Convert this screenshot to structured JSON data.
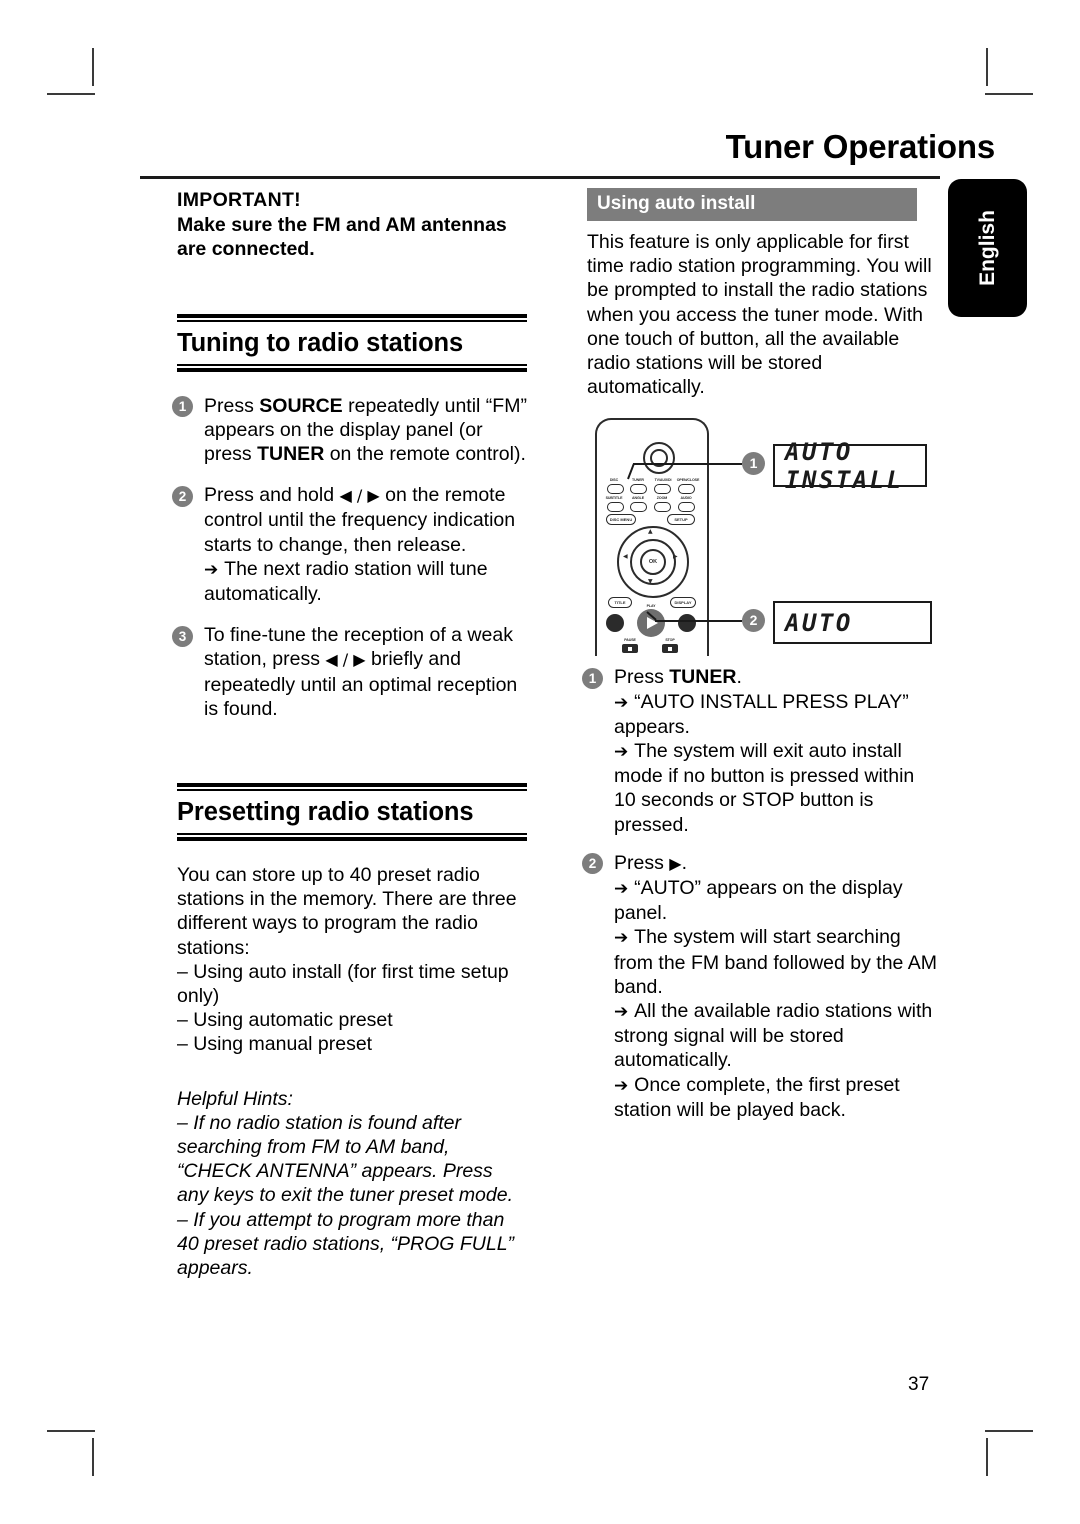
{
  "header": {
    "title": "Tuner Operations",
    "language_tab": "English"
  },
  "page_number": "37",
  "left_column": {
    "important": {
      "heading": "IMPORTANT!",
      "line1": "Make sure the FM and AM antennas",
      "line2": "are connected."
    },
    "section1": {
      "heading": "Tuning to radio stations",
      "steps": [
        {
          "num": "1",
          "parts": [
            {
              "t": "Press ",
              "b": false
            },
            {
              "t": "SOURCE",
              "b": true
            },
            {
              "t": " repeatedly until “FM” appears on the display panel (or press ",
              "b": false
            },
            {
              "t": "TUNER",
              "b": true
            },
            {
              "t": " on the remote control).",
              "b": false
            }
          ],
          "notes": []
        },
        {
          "num": "2",
          "parts": [
            {
              "t": "Press and hold ",
              "b": false
            },
            {
              "t": "◀ / ▶",
              "b": false,
              "tri": true
            },
            {
              "t": " on the remote control until the frequency indication starts to change, then release.",
              "b": false
            }
          ],
          "notes": [
            "The next radio station will tune automatically."
          ]
        },
        {
          "num": "3",
          "parts": [
            {
              "t": "To fine-tune the reception of a weak station, press ",
              "b": false
            },
            {
              "t": "◀ / ▶",
              "b": false,
              "tri": true
            },
            {
              "t": " briefly and repeatedly until an optimal reception is found.",
              "b": false
            }
          ],
          "notes": []
        }
      ]
    },
    "section2": {
      "heading": "Presetting radio stations",
      "intro": "You can store up to 40 preset radio stations in the memory.  There are three different ways to program the radio stations:",
      "dash_items": [
        "Using auto install (for first time setup only)",
        "Using automatic preset",
        "Using manual preset"
      ],
      "hints_heading": "Helpful Hints:",
      "hints": [
        "If no radio station is found after searching from FM to AM band, “CHECK ANTENNA” appears.  Press any keys to exit the tuner preset mode.",
        "If you attempt to program more than 40 preset radio stations, “PROG FULL” appears."
      ]
    }
  },
  "right_column": {
    "subhead": "Using auto install",
    "intro": "This feature is only applicable for first time radio station programming.  You will be prompted to install the radio stations when you access the tuner mode.  With one touch of button, all the available radio stations will be stored automatically.",
    "figure": {
      "remote_buttons_row1": [
        "DISC",
        "TUNER",
        "TV/AUX/DI",
        "OPEN/CLOSE"
      ],
      "remote_buttons_row2": [
        "SUBTITLE",
        "ANGLE",
        "ZOOM",
        "AUDIO"
      ],
      "remote_disc_menu": "DISC MENU",
      "remote_setup": "SETUP",
      "remote_ok": "OK",
      "remote_title": "TITLE",
      "remote_display": "DISPLAY",
      "remote_play": "PLAY",
      "remote_pause": "PAUSE",
      "remote_stop": "STOP",
      "callout1": "1",
      "callout2": "2",
      "lcd1": "AUTO INSTALL",
      "lcd2": "AUTO"
    },
    "steps": [
      {
        "num": "1",
        "parts": [
          {
            "t": "Press ",
            "b": false
          },
          {
            "t": "TUNER",
            "b": true
          },
          {
            "t": ".",
            "b": false
          }
        ],
        "notes": [
          "“AUTO INSTALL PRESS PLAY” appears.",
          "The system will exit auto install mode if no button is pressed within 10 seconds or STOP button is pressed."
        ]
      },
      {
        "num": "2",
        "parts": [
          {
            "t": "Press ",
            "b": false
          },
          {
            "t": "▶",
            "b": false,
            "tri": true
          },
          {
            "t": ".",
            "b": false
          }
        ],
        "notes": [
          "“AUTO” appears on the display panel.",
          "The system will start searching from the FM band followed by the AM band.",
          "All the available radio stations with strong signal will be stored automatically.",
          "Once complete, the first preset station will be played back."
        ]
      }
    ]
  },
  "colors": {
    "accent_grey": "#7d7d7d",
    "ink": "#1a1a1a"
  }
}
